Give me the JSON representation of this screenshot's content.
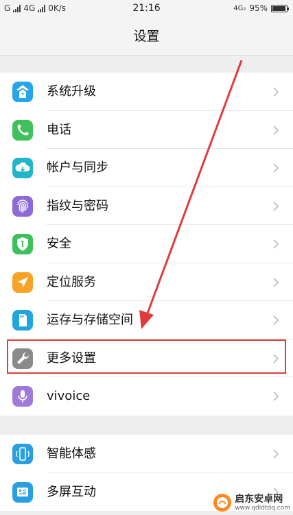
{
  "status_bar": {
    "carrier1": "G",
    "carrier2": "4G",
    "speed": "0K/s",
    "time": "21:16",
    "network": "4G₂",
    "battery_percent": "95%",
    "battery_level": 0.95
  },
  "header": {
    "title": "设置"
  },
  "groups": [
    {
      "items": [
        {
          "label": "系统升级",
          "icon": "upgrade-icon",
          "color": "#26a6e8"
        },
        {
          "label": "电话",
          "icon": "phone-icon",
          "color": "#3fc25b"
        },
        {
          "label": "帐户与同步",
          "icon": "cloud-sync-icon",
          "color": "#1fb6c8"
        },
        {
          "label": "指纹与密码",
          "icon": "fingerprint-icon",
          "color": "#8d6ad8"
        },
        {
          "label": "安全",
          "icon": "shield-icon",
          "color": "#3ec05b"
        },
        {
          "label": "定位服务",
          "icon": "location-arrow-icon",
          "color": "#f6a427"
        },
        {
          "label": "运存与存储空间",
          "icon": "storage-card-icon",
          "color": "#22a5dc"
        },
        {
          "label": "更多设置",
          "icon": "wrench-icon",
          "color": "#8a8a8a"
        },
        {
          "label": "vivoice",
          "icon": "microphone-icon",
          "color": "#a07adb"
        }
      ]
    },
    {
      "items": [
        {
          "label": "智能体感",
          "icon": "motion-phone-icon",
          "color": "#2a9fe0"
        },
        {
          "label": "多屏互动",
          "icon": "multiscreen-icon",
          "color": "#2a9fe0"
        }
      ]
    }
  ],
  "watermark": {
    "title": "启东安卓网",
    "url": "www.qdldtdq.com"
  },
  "colors": {
    "highlight": "#e03b3b",
    "arrow": "#e03b3b"
  }
}
